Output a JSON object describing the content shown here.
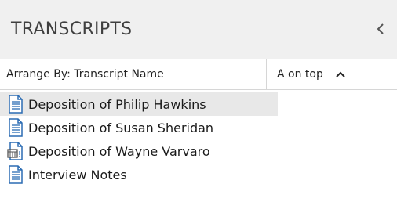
{
  "header": {
    "title": "TRANSCRIPTS",
    "collapse_icon": "chevron-left-icon"
  },
  "arrange": {
    "arrange_by_label": "Arrange By: Transcript Name",
    "sort_label": "A on top",
    "sort_icon": "chevron-up-icon"
  },
  "transcripts": [
    {
      "label": "Deposition of Philip Hawkins",
      "icon": "document-icon",
      "selected": true
    },
    {
      "label": "Deposition of Susan Sheridan",
      "icon": "document-icon",
      "selected": false
    },
    {
      "label": "Deposition of Wayne Varvaro",
      "icon": "multimedia-document-icon",
      "selected": false
    },
    {
      "label": "Interview Notes",
      "icon": "document-icon",
      "selected": false
    }
  ],
  "colors": {
    "header_bg": "#f0f0f0",
    "selected_bg": "#e8e8e8",
    "icon_blue": "#2b6cb3"
  }
}
